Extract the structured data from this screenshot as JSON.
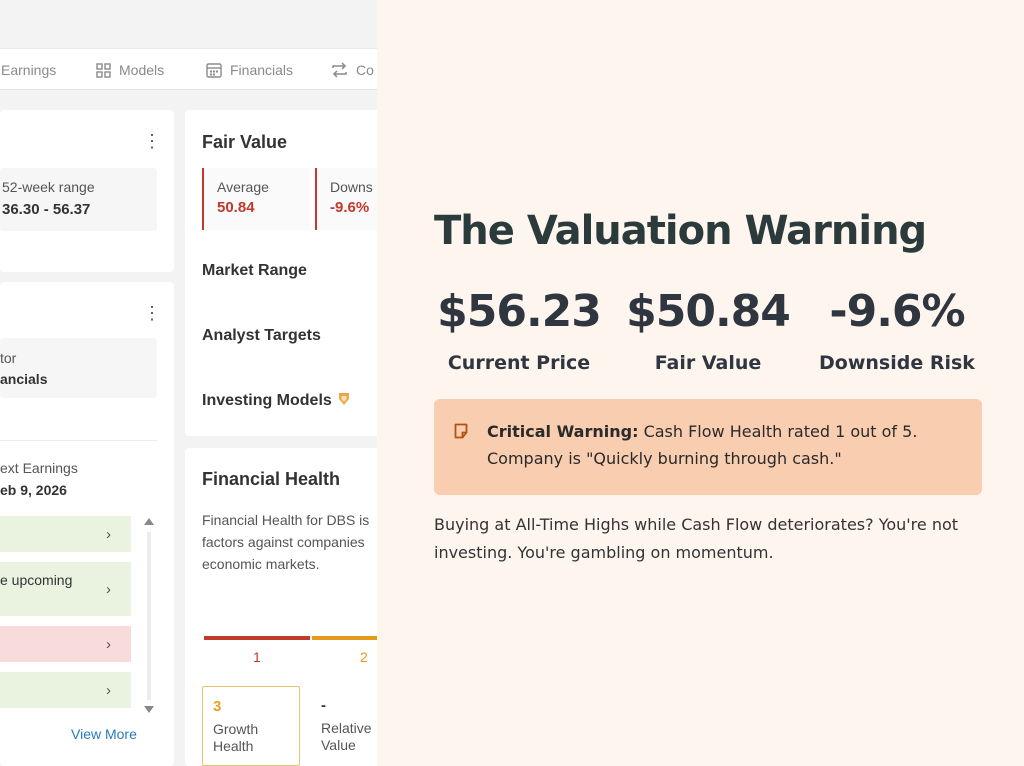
{
  "tabs": [
    {
      "label": "Earnings",
      "icon": "earnings-icon"
    },
    {
      "label": "Models",
      "icon": "grid-icon"
    },
    {
      "label": "Financials",
      "icon": "calendar-icon"
    },
    {
      "label": "Co",
      "icon": "compare-icon"
    }
  ],
  "stats_card": {
    "range_label": "52-week range",
    "range_value": "36.30 - 56.37"
  },
  "info_card": {
    "sector_label": "tor",
    "sector_value": "ancials",
    "earnings_label": "ext Earnings",
    "earnings_value": "eb 9, 2026",
    "rows": [
      {
        "text": "",
        "tone": "green"
      },
      {
        "text": "e upcoming",
        "tone": "green"
      },
      {
        "text": "",
        "tone": "red"
      },
      {
        "text": "",
        "tone": "green"
      }
    ],
    "view_more": "View More"
  },
  "fair_value_card": {
    "title": "Fair Value",
    "average_label": "Average",
    "average_value": "50.84",
    "downside_label": "Downs",
    "downside_value": "-9.6%",
    "sections": [
      "Market Range",
      "Analyst Targets",
      "Investing Models"
    ]
  },
  "financial_health_card": {
    "title": "Financial Health",
    "description": "Financial Health for DBS is factors against companies economic markets.",
    "scale": [
      {
        "label": "1",
        "color": "#c0392b"
      },
      {
        "label": "2",
        "color": "#e69a1d"
      }
    ],
    "growth_score": "3",
    "growth_label": "Growth Health",
    "relative_score": "-",
    "relative_label": "Relative Value"
  },
  "headline": "The Valuation Warning",
  "stats": [
    {
      "value": "$56.23",
      "label": "Current Price"
    },
    {
      "value": "$50.84",
      "label": "Fair Value"
    },
    {
      "value": "-9.6%",
      "label": "Downside Risk"
    }
  ],
  "warning": {
    "title": "Critical Warning:",
    "text": "Cash Flow Health rated 1 out of 5. Company is \"Quickly burning through cash.\""
  },
  "body": "Buying at All-Time Highs while Cash Flow deteriorates? You're not investing. You're gambling on momentum.",
  "colors": {
    "background": "#fdf5ee",
    "warning_bg": "#f9cdb0",
    "negative": "#c0392b",
    "positive_row": "#eaf3e0",
    "negative_row": "#f8dcdc",
    "link": "#2a7ab8"
  }
}
